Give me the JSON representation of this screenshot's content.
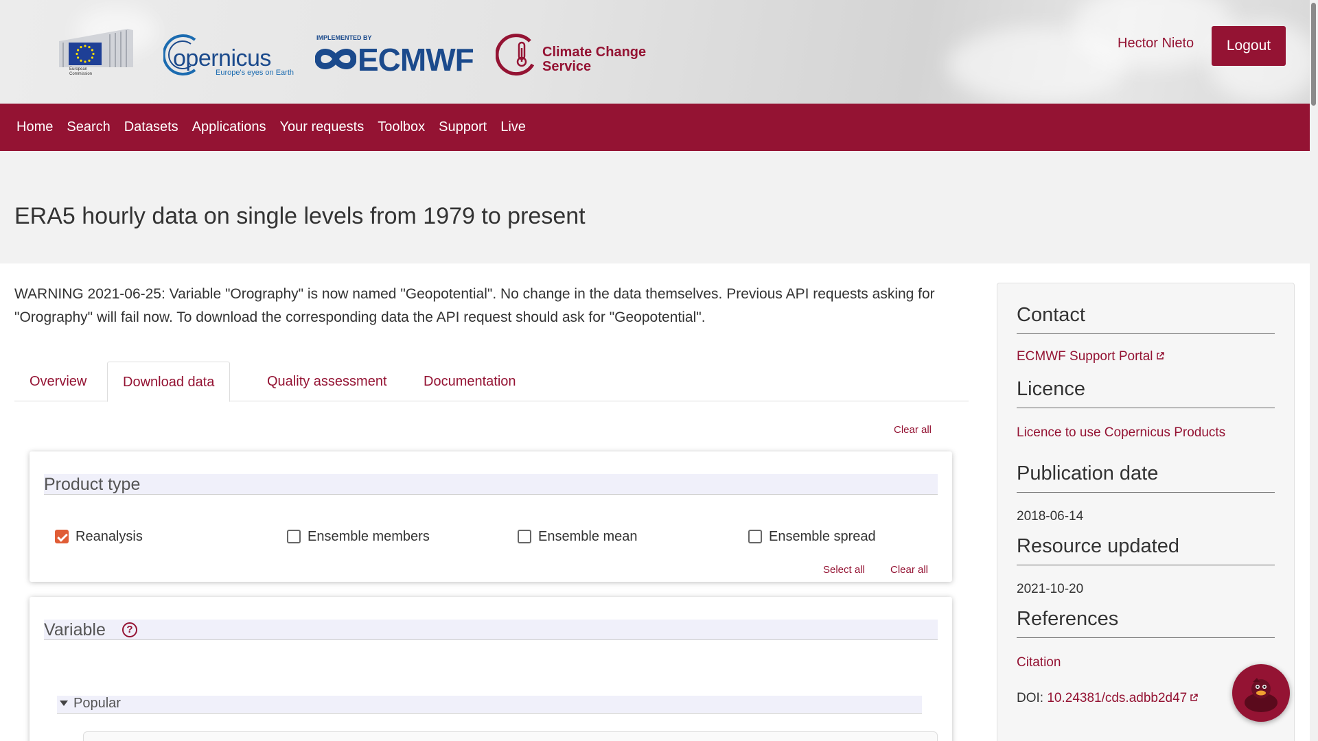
{
  "header": {
    "eu_caption": "European Commission",
    "copernicus_word": "opernicus",
    "copernicus_tagline": "Europe's eyes on Earth",
    "ecmwf_implemented": "IMPLEMENTED BY",
    "ecmwf_word": "ECMWF",
    "ccs_line1": "Climate Change",
    "ccs_line2": "Service",
    "user_name": "Hector Nieto",
    "logout_label": "Logout"
  },
  "nav": {
    "items": [
      "Home",
      "Search",
      "Datasets",
      "Applications",
      "Your requests",
      "Toolbox",
      "Support",
      "Live"
    ]
  },
  "page": {
    "title": "ERA5 hourly data on single levels from 1979 to present",
    "warning": "WARNING 2021-06-25: Variable \"Orography\" is now named \"Geopotential\". No change in the data themselves. Previous API requests asking for \"Orography\" will fail now. To download the corresponding data the API request should ask for \"Geopotential\"."
  },
  "tabs": [
    {
      "label": "Overview",
      "active": false
    },
    {
      "label": "Download data",
      "active": true
    },
    {
      "label": "Quality assessment",
      "active": false
    },
    {
      "label": "Documentation",
      "active": false
    }
  ],
  "form": {
    "clear_all_top": "Clear all",
    "product_type": {
      "title": "Product type",
      "options": [
        {
          "label": "Reanalysis",
          "checked": true
        },
        {
          "label": "Ensemble members",
          "checked": false
        },
        {
          "label": "Ensemble mean",
          "checked": false
        },
        {
          "label": "Ensemble spread",
          "checked": false
        }
      ],
      "select_all": "Select all",
      "clear_all": "Clear all"
    },
    "variable": {
      "title": "Variable",
      "help_glyph": "?",
      "popular_label": "Popular"
    }
  },
  "sidebar": {
    "contact_heading": "Contact",
    "contact_link": "ECMWF Support Portal",
    "licence_heading": "Licence",
    "licence_link": "Licence to use Copernicus Products",
    "publication_heading": "Publication date",
    "publication_date": "2018-06-14",
    "updated_heading": "Resource updated",
    "updated_date": "2021-10-20",
    "references_heading": "References",
    "citation_link": "Citation",
    "doi_label": "DOI: ",
    "doi_link": "10.24381/cds.adbb2d47"
  },
  "colors": {
    "brand": "#941333",
    "checkbox_accent": "#e05d36"
  }
}
